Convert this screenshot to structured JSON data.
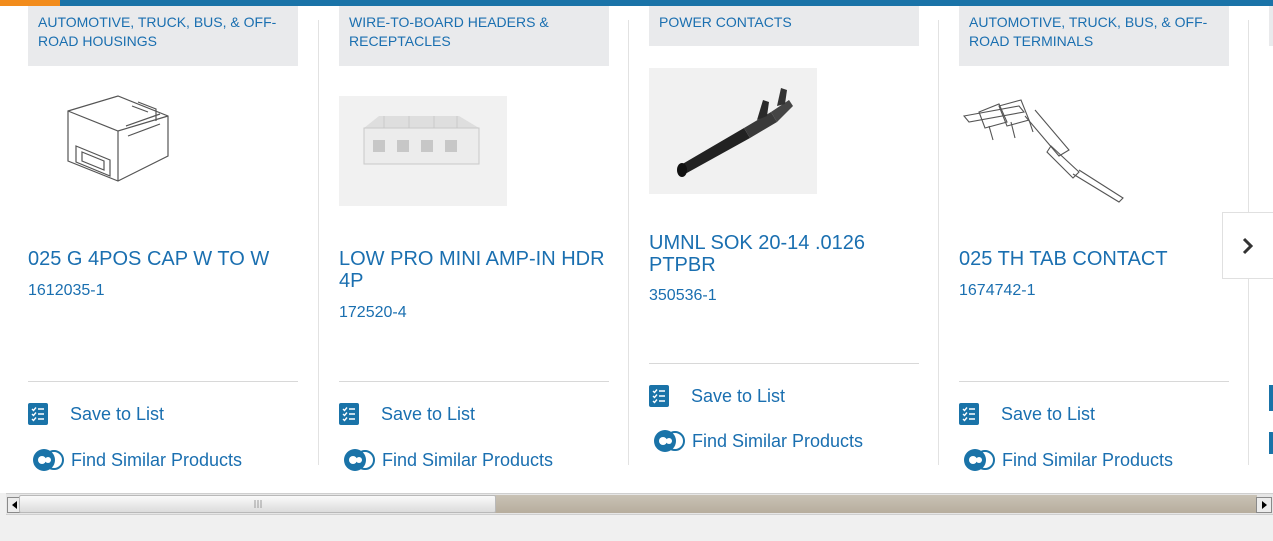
{
  "products": [
    {
      "category": "AUTOMOTIVE, TRUCK, BUS, & OFF-ROAD HOUSINGS",
      "title": "025 G 4POS CAP W TO W",
      "part_number": "1612035-1",
      "image_icon": "connector-housing-image"
    },
    {
      "category": "WIRE-TO-BOARD HEADERS & RECEPTACLES",
      "title": "LOW PRO MINI AMP-IN HDR 4P",
      "part_number": "172520-4",
      "image_icon": "header-receptacle-image"
    },
    {
      "category": "POWER CONTACTS",
      "title": "UMNL SOK 20-14 .0126 PTPBR",
      "part_number": "350536-1",
      "image_icon": "power-contact-image"
    },
    {
      "category": "AUTOMOTIVE, TRUCK, BUS, & OFF-ROAD TERMINALS",
      "title": "025 TH TAB CONTACT",
      "part_number": "1674742-1",
      "image_icon": "tab-terminal-image"
    }
  ],
  "actions": {
    "save_label": "Save to List",
    "similar_label": "Find Similar Products"
  },
  "colors": {
    "brand_blue": "#1a6fb0",
    "accent_orange": "#f28c1c",
    "category_bg": "#e9eaec"
  }
}
